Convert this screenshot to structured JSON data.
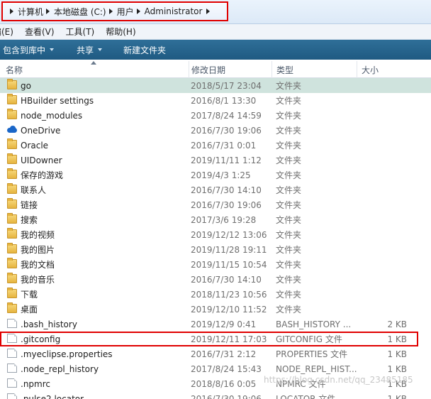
{
  "breadcrumb": {
    "items": [
      "计算机",
      "本地磁盘 (C:)",
      "用户",
      "Administrator"
    ]
  },
  "menubar": {
    "items": [
      "编(E)",
      "查看(V)",
      "工具(T)",
      "帮助(H)"
    ]
  },
  "commandbar": {
    "include": "包含到库中",
    "share": "共享",
    "new_folder": "新建文件夹"
  },
  "columns": {
    "name": "名称",
    "date": "修改日期",
    "type": "类型",
    "size": "大小"
  },
  "rows": [
    {
      "name": "go",
      "date": "2018/5/17 23:04",
      "type": "文件夹",
      "size": "",
      "icon": "folder-icon"
    },
    {
      "name": "HBuilder settings",
      "date": "2016/8/1 13:30",
      "type": "文件夹",
      "size": "",
      "icon": "folder-icon"
    },
    {
      "name": "node_modules",
      "date": "2017/8/24 14:59",
      "type": "文件夹",
      "size": "",
      "icon": "folder-icon"
    },
    {
      "name": "OneDrive",
      "date": "2016/7/30 19:06",
      "type": "文件夹",
      "size": "",
      "icon": "onedrive-icon"
    },
    {
      "name": "Oracle",
      "date": "2016/7/31 0:01",
      "type": "文件夹",
      "size": "",
      "icon": "folder-icon"
    },
    {
      "name": "UIDowner",
      "date": "2019/11/11 1:12",
      "type": "文件夹",
      "size": "",
      "icon": "folder-icon"
    },
    {
      "name": "保存的游戏",
      "date": "2019/4/3 1:25",
      "type": "文件夹",
      "size": "",
      "icon": "folder-icon"
    },
    {
      "name": "联系人",
      "date": "2016/7/30 14:10",
      "type": "文件夹",
      "size": "",
      "icon": "folder-icon"
    },
    {
      "name": "链接",
      "date": "2016/7/30 19:06",
      "type": "文件夹",
      "size": "",
      "icon": "folder-icon"
    },
    {
      "name": "搜索",
      "date": "2017/3/6 19:28",
      "type": "文件夹",
      "size": "",
      "icon": "folder-icon"
    },
    {
      "name": "我的视频",
      "date": "2019/12/12 13:06",
      "type": "文件夹",
      "size": "",
      "icon": "folder-icon"
    },
    {
      "name": "我的图片",
      "date": "2019/11/28 19:11",
      "type": "文件夹",
      "size": "",
      "icon": "folder-icon"
    },
    {
      "name": "我的文档",
      "date": "2019/11/15 10:54",
      "type": "文件夹",
      "size": "",
      "icon": "folder-icon"
    },
    {
      "name": "我的音乐",
      "date": "2016/7/30 14:10",
      "type": "文件夹",
      "size": "",
      "icon": "folder-icon"
    },
    {
      "name": "下载",
      "date": "2018/11/23 10:56",
      "type": "文件夹",
      "size": "",
      "icon": "folder-icon"
    },
    {
      "name": "桌面",
      "date": "2019/12/10 11:52",
      "type": "文件夹",
      "size": "",
      "icon": "folder-icon"
    },
    {
      "name": ".bash_history",
      "date": "2019/12/9 0:41",
      "type": "BASH_HISTORY ...",
      "size": "2 KB",
      "icon": "file-icon"
    },
    {
      "name": ".gitconfig",
      "date": "2019/12/11 17:03",
      "type": "GITCONFIG 文件",
      "size": "1 KB",
      "icon": "file-icon"
    },
    {
      "name": ".myeclipse.properties",
      "date": "2016/7/31 2:12",
      "type": "PROPERTIES 文件",
      "size": "1 KB",
      "icon": "file-icon"
    },
    {
      "name": ".node_repl_history",
      "date": "2017/8/24 15:43",
      "type": "NODE_REPL_HIST...",
      "size": "1 KB",
      "icon": "file-icon"
    },
    {
      "name": ".npmrc",
      "date": "2018/8/16 0:05",
      "type": "NPMRC 文件",
      "size": "1 KB",
      "icon": "file-icon"
    },
    {
      "name": ".pulse2.locator",
      "date": "2016/7/30 19:06",
      "type": "LOCATOR 文件",
      "size": "1 KB",
      "icon": "file-icon"
    }
  ],
  "watermark": "https://blog.csdn.net/qq_23485185"
}
